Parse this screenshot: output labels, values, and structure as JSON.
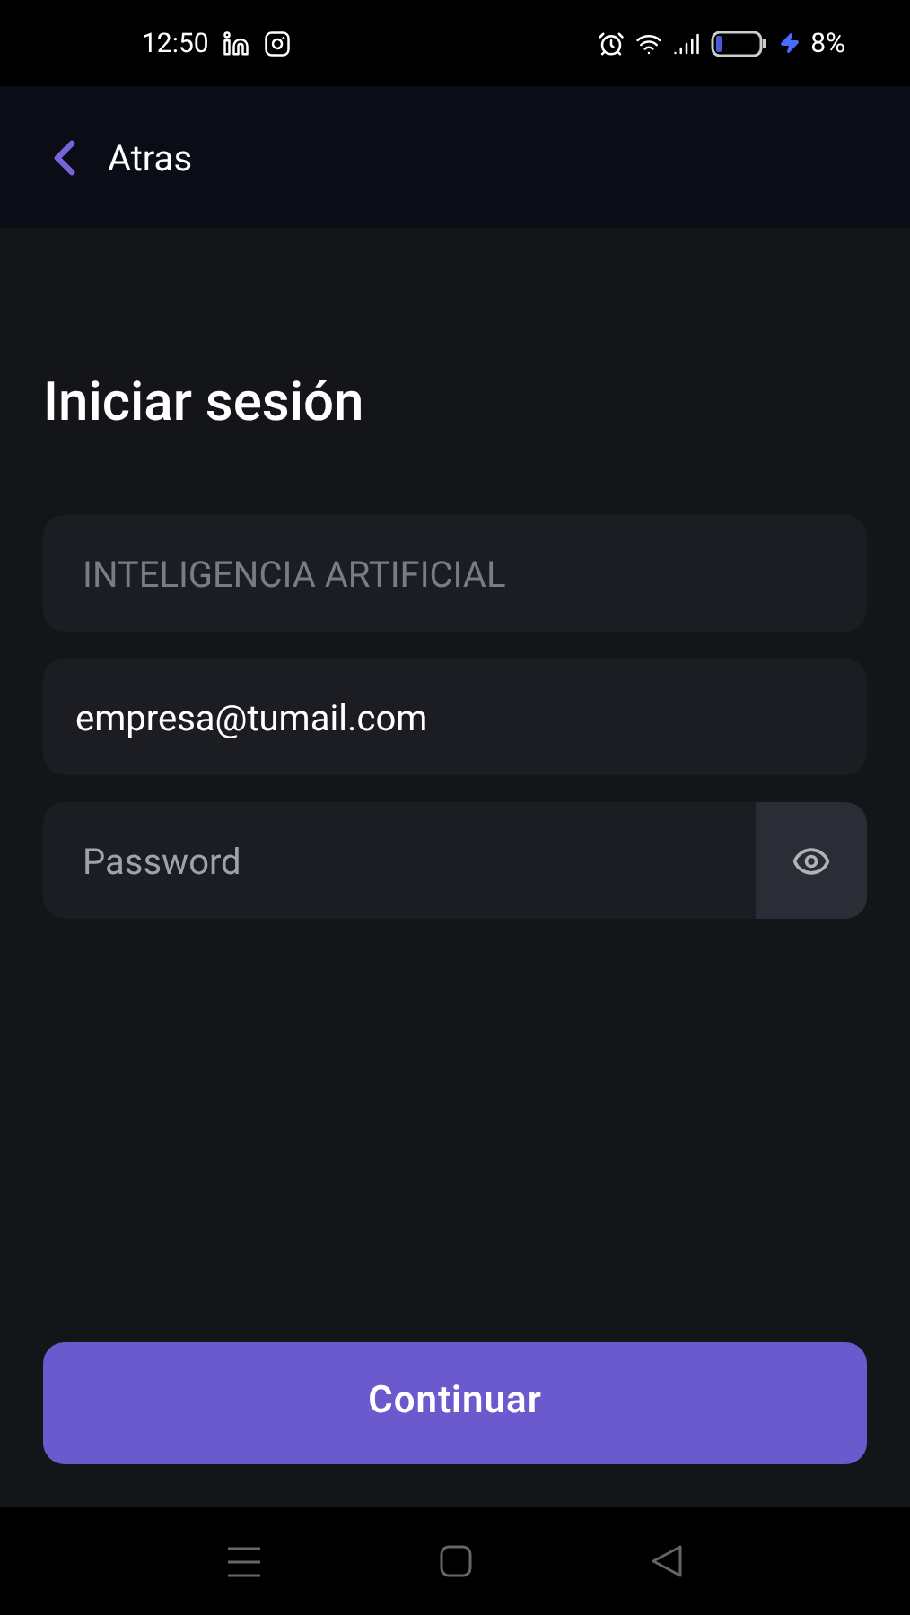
{
  "status_bar": {
    "time": "12:50",
    "battery": "8%"
  },
  "header": {
    "back_label": "Atras"
  },
  "title": "Iniciar sesión",
  "fields": [
    {
      "kind": "text",
      "value": "INTELIGENCIA ARTIFICIAL",
      "disabled": true
    },
    {
      "kind": "text",
      "value": "empresa@tumail.com",
      "disabled": false
    },
    {
      "kind": "password",
      "placeholder": "Password",
      "disabled": false
    }
  ],
  "submit": {
    "label": "Continuar"
  }
}
